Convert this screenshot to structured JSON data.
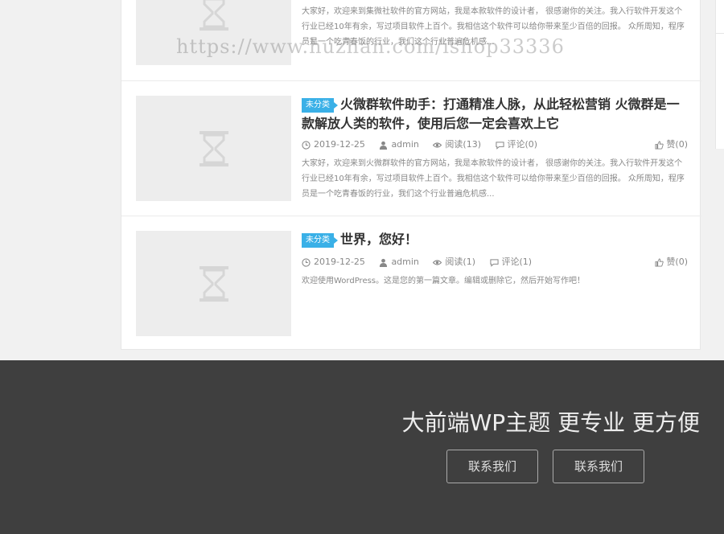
{
  "watermark": "https://www.huzhan.com/ishop33336",
  "posts": [
    {
      "excerpt": "大家好，欢迎来到集微社软件的官方网站，我是本款软件的设计者， 很感谢你的关注。我入行软件开发这个行业已经10年有余，写过项目软件上百个。我相信这个软件可以给你带来至少百倍的回报。 众所周知，程序员是一个吃青春饭的行业，我们这个行业普遍危机感..."
    },
    {
      "category": "未分类",
      "title": "火微群软件助手：打通精准人脉，从此轻松营销 火微群是一款解放人类的软件，使用后您一定会喜欢上它",
      "date": "2019-12-25",
      "author": "admin",
      "reads": "阅读(13)",
      "comments": "评论(0)",
      "likes": "赞(0)",
      "excerpt": "大家好，欢迎来到火微群软件的官方网站，我是本款软件的设计者， 很感谢你的关注。我入行软件开发这个行业已经10年有余，写过项目软件上百个。我相信这个软件可以给你带来至少百倍的回报。 众所周知，程序员是一个吃青春饭的行业，我们这个行业普遍危机感..."
    },
    {
      "category": "未分类",
      "title": "世界，您好！",
      "date": "2019-12-25",
      "author": "admin",
      "reads": "阅读(1)",
      "comments": "评论(1)",
      "likes": "赞(0)",
      "excerpt": "欢迎使用WordPress。这是您的第一篇文章。编辑或删除它，然后开始写作吧！"
    }
  ],
  "footer": {
    "slogan": "大前端WP主题 更专业 更方便",
    "button1": "联系我们",
    "button2": "联系我们"
  },
  "colors": {
    "category_badge": "#3ab0e7",
    "footer_bg": "#3f3f3f"
  }
}
